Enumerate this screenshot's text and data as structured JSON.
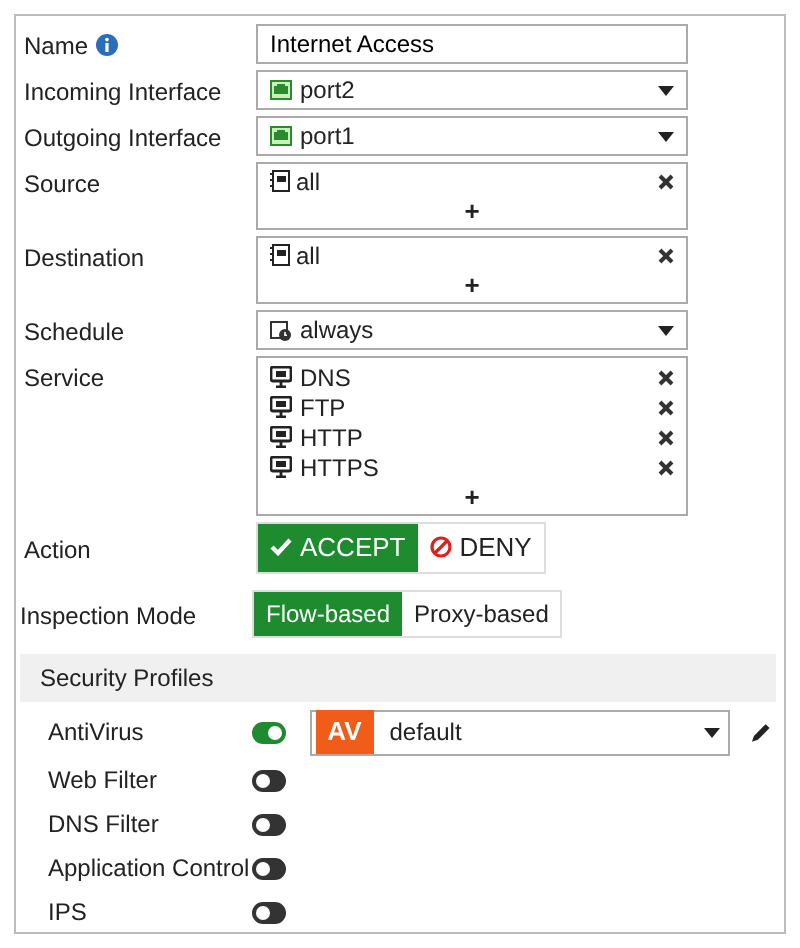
{
  "rows": [
    {
      "kind": "text",
      "label": "Name",
      "info": true,
      "value": "Internet Access"
    },
    {
      "kind": "interface",
      "label": "Incoming Interface",
      "value": "port2"
    },
    {
      "kind": "interface",
      "label": "Outgoing Interface",
      "value": "port1"
    },
    {
      "kind": "address",
      "label": "Source",
      "items": [
        "all"
      ],
      "add": "+"
    },
    {
      "kind": "address",
      "label": "Destination",
      "items": [
        "all"
      ],
      "add": "+"
    },
    {
      "kind": "schedule",
      "label": "Schedule",
      "value": "always"
    },
    {
      "kind": "service",
      "label": "Service",
      "items": [
        "DNS",
        "FTP",
        "HTTP",
        "HTTPS"
      ],
      "add": "+"
    }
  ],
  "action": {
    "label": "Action",
    "options": [
      {
        "label": "ACCEPT",
        "selected": true
      },
      {
        "label": "DENY",
        "selected": false
      }
    ]
  },
  "inspection_mode": {
    "label": "Inspection Mode",
    "options": [
      {
        "label": "Flow-based",
        "selected": true
      },
      {
        "label": "Proxy-based",
        "selected": false
      }
    ]
  },
  "security_profiles": {
    "title": "Security Profiles",
    "items": [
      {
        "label": "AntiVirus",
        "on": true,
        "profile": {
          "badge": "AV",
          "value": "default"
        }
      },
      {
        "label": "Web Filter",
        "on": false
      },
      {
        "label": "DNS Filter",
        "on": false
      },
      {
        "label": "Application Control",
        "on": false
      },
      {
        "label": "IPS",
        "on": false
      }
    ]
  }
}
